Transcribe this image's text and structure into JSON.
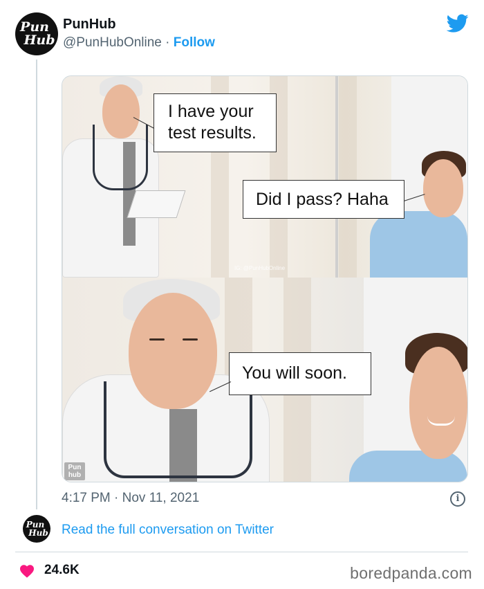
{
  "tweet": {
    "display_name": "PunHub",
    "handle": "@PunHubOnline",
    "separator": " · ",
    "follow_label": "Follow",
    "avatar_line1": "Pun",
    "avatar_line2": "Hub",
    "timestamp": "4:17 PM · Nov 11, 2021",
    "read_more": "Read the full conversation on Twitter",
    "likes": "24.6K",
    "info_icon": "i"
  },
  "meme": {
    "bubble_1": "I have your test results.",
    "bubble_2": "Did I pass? Haha",
    "bubble_3": "You will soon.",
    "watermark": "IG: @PunHubOnline",
    "logo_line1": "Pun",
    "logo_line2": "hub"
  },
  "footer": {
    "brand": "boredpanda.com"
  },
  "colors": {
    "twitter_blue": "#1d9bf0",
    "secondary_text": "#536471",
    "like_heart": "#f91880"
  },
  "icons": [
    "twitter-bird-icon",
    "info-icon",
    "heart-icon"
  ]
}
